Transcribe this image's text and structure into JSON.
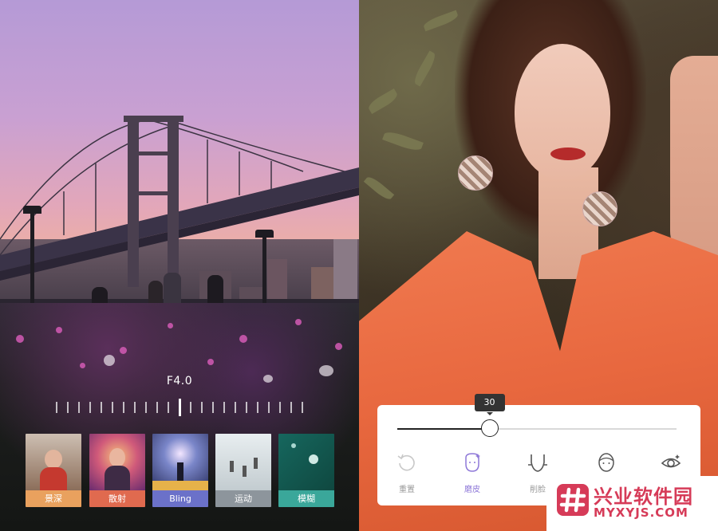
{
  "left_screen": {
    "aperture_label": "F4.0",
    "filters": [
      {
        "label": "景深",
        "label_color": "#e9a15e"
      },
      {
        "label": "散射",
        "label_color": "#e06a4f"
      },
      {
        "label": "Bling",
        "label_color": "#6b71c9"
      },
      {
        "label": "运动",
        "label_color": "#8d959c"
      },
      {
        "label": "模糊",
        "label_color": "#3aa79a"
      }
    ]
  },
  "right_screen": {
    "slider_value": "30",
    "slider_fraction": 0.33,
    "tools": [
      {
        "label": "重置",
        "icon": "reset-icon",
        "active": false
      },
      {
        "label": "磨皮",
        "icon": "smooth-skin-icon",
        "active": true
      },
      {
        "label": "削脸",
        "icon": "slim-face-icon",
        "active": false
      },
      {
        "label": "",
        "icon": "face-outline-icon",
        "active": false
      },
      {
        "label": "",
        "icon": "eye-icon",
        "active": false
      }
    ],
    "active_color": "#8e78d8"
  },
  "watermark": {
    "title": "兴业软件园",
    "subtitle": "MYXYJS.COM",
    "color": "#d63b58"
  }
}
